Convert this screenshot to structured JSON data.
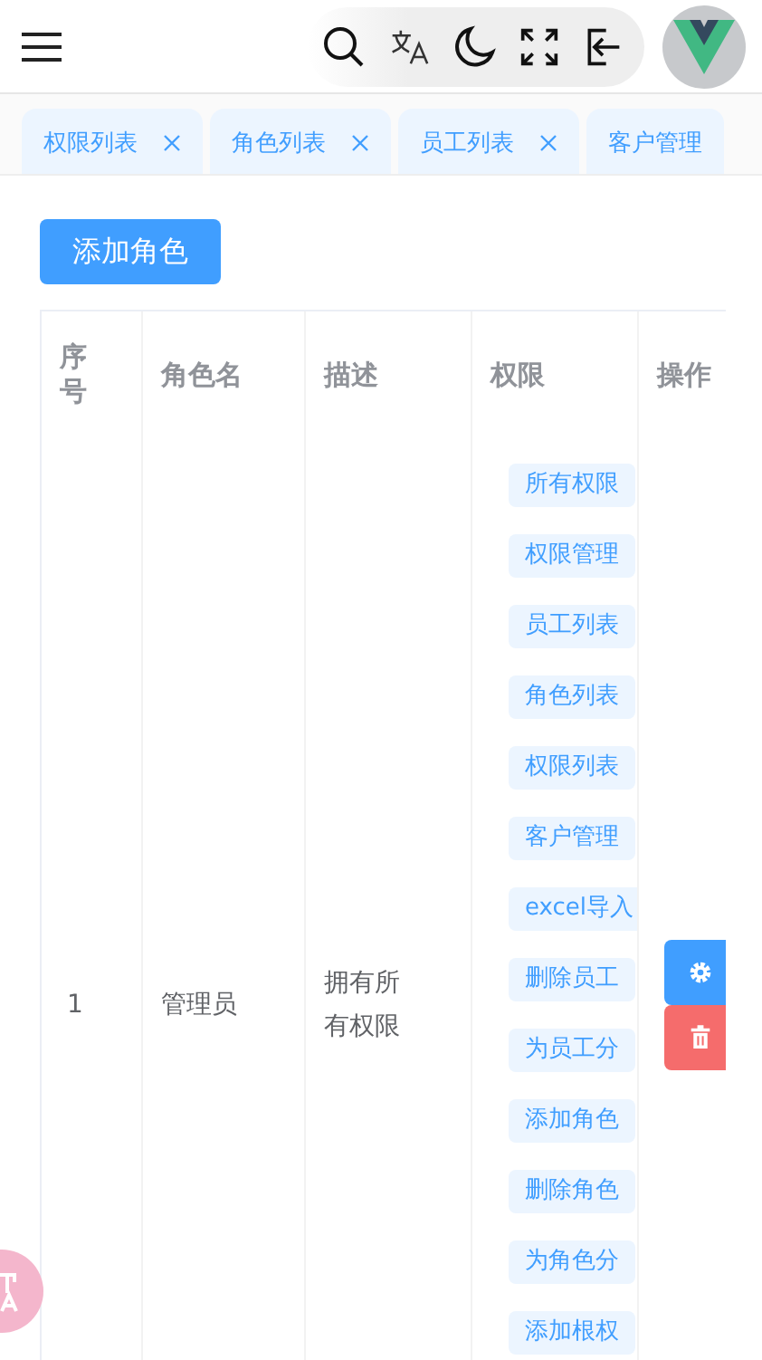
{
  "header": {
    "avatar": {
      "kind": "logo"
    }
  },
  "tabs": [
    {
      "label": "权限列表",
      "closable": true
    },
    {
      "label": "角色列表",
      "closable": true
    },
    {
      "label": "员工列表",
      "closable": true
    },
    {
      "label": "客户管理",
      "closable": false
    }
  ],
  "add_button": "添加角色",
  "table": {
    "columns": [
      "序号",
      "角色名",
      "描述",
      "权限",
      "操作"
    ],
    "rows": [
      {
        "index": "1",
        "name": "管理员",
        "description": "拥有所有权限",
        "permissions": [
          "所有权限",
          "权限管理",
          "员工列表",
          "角色列表",
          "权限列表",
          "客户管理",
          "excel导入",
          "删除员工",
          "为员工分",
          "添加角色",
          "删除角色",
          "为角色分",
          "添加根权"
        ]
      }
    ]
  }
}
